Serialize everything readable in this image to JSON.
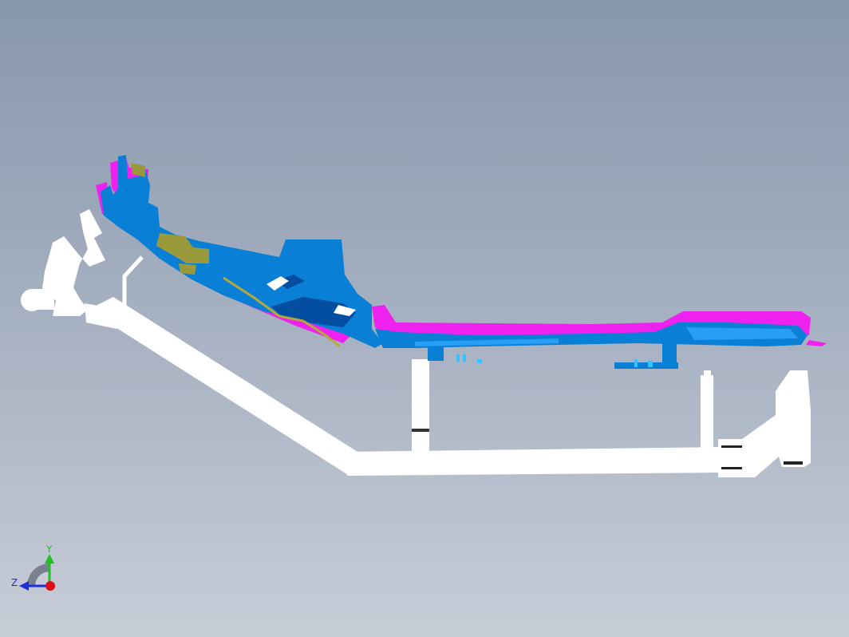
{
  "viewport": {
    "background_top": "#8797ac",
    "background_bottom": "#c7cdd7"
  },
  "model": {
    "parts": [
      {
        "name": "support-fixture",
        "color": "#ffffff"
      },
      {
        "name": "blue-panel",
        "color": "#0a7fd6"
      },
      {
        "name": "magenta-panel",
        "color": "#ee22ee"
      },
      {
        "name": "olive-bracket",
        "color": "#9a9a3a"
      }
    ]
  },
  "triad": {
    "y_label": "Y",
    "z_label": "Z",
    "y_color": "#1fbf1f",
    "z_color": "#1c2fd9",
    "x_color": "#e0101a",
    "icon": "axis-triad-icon"
  }
}
